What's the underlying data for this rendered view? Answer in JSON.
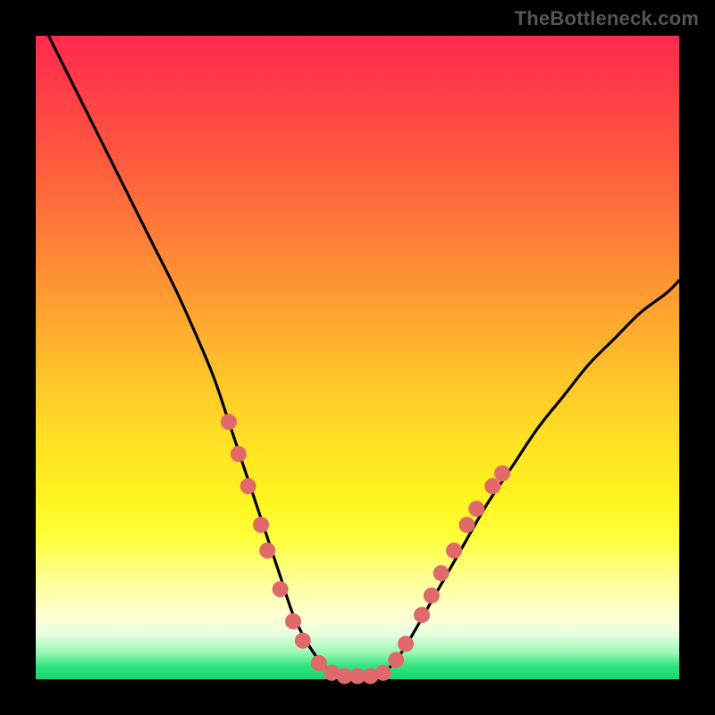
{
  "watermark": "TheBottleneck.com",
  "chart_data": {
    "type": "line",
    "title": "",
    "xlabel": "",
    "ylabel": "",
    "xlim": [
      0,
      100
    ],
    "ylim": [
      0,
      100
    ],
    "series": [
      {
        "name": "bottleneck-curve",
        "x": [
          2,
          6,
          10,
          14,
          18,
          22,
          26,
          28,
          30,
          32,
          34,
          36,
          38,
          40,
          42,
          44,
          46,
          48,
          50,
          52,
          54,
          56,
          58,
          62,
          66,
          70,
          74,
          78,
          82,
          86,
          90,
          94,
          98,
          100
        ],
        "y": [
          100,
          92,
          84,
          76,
          68,
          60,
          51,
          46,
          40,
          34,
          28,
          22,
          16,
          10,
          6,
          3,
          1,
          0.5,
          0.5,
          0.5,
          1,
          3,
          6,
          13,
          20,
          27,
          33,
          39,
          44,
          49,
          53,
          57,
          60,
          62
        ]
      }
    ],
    "markers": {
      "name": "highlight-dots",
      "color": "#e06a6a",
      "points": [
        {
          "x": 30,
          "y": 40
        },
        {
          "x": 31.5,
          "y": 35
        },
        {
          "x": 33,
          "y": 30
        },
        {
          "x": 35,
          "y": 24
        },
        {
          "x": 36,
          "y": 20
        },
        {
          "x": 38,
          "y": 14
        },
        {
          "x": 40,
          "y": 9
        },
        {
          "x": 41.5,
          "y": 6
        },
        {
          "x": 44,
          "y": 2.5
        },
        {
          "x": 46,
          "y": 1
        },
        {
          "x": 48,
          "y": 0.5
        },
        {
          "x": 50,
          "y": 0.5
        },
        {
          "x": 52,
          "y": 0.5
        },
        {
          "x": 54,
          "y": 1
        },
        {
          "x": 56,
          "y": 3
        },
        {
          "x": 57.5,
          "y": 5.5
        },
        {
          "x": 60,
          "y": 10
        },
        {
          "x": 61.5,
          "y": 13
        },
        {
          "x": 63,
          "y": 16.5
        },
        {
          "x": 65,
          "y": 20
        },
        {
          "x": 67,
          "y": 24
        },
        {
          "x": 68.5,
          "y": 26.5
        },
        {
          "x": 71,
          "y": 30
        },
        {
          "x": 72.5,
          "y": 32
        }
      ]
    }
  }
}
